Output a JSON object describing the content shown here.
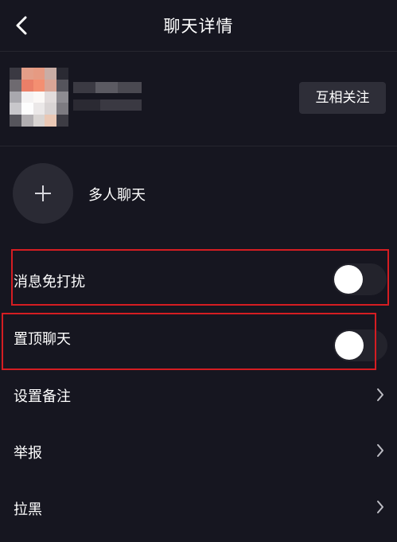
{
  "header": {
    "title": "聊天详情",
    "back_icon": "chevron-left-icon"
  },
  "profile": {
    "avatar_icon": "blurred-avatar",
    "follow_label": "互相关注"
  },
  "group_chat": {
    "icon": "plus-icon",
    "label": "多人聊天"
  },
  "settings": {
    "mute": {
      "label": "消息免打扰",
      "enabled": false
    },
    "pin": {
      "label": "置顶聊天",
      "enabled": false
    },
    "remark": {
      "label": "设置备注",
      "icon": "chevron-right-icon"
    },
    "report": {
      "label": "举报",
      "icon": "chevron-right-icon"
    },
    "block": {
      "label": "拉黑",
      "icon": "chevron-right-icon"
    }
  },
  "colors": {
    "background": "#161620",
    "highlight_box": "#d51d22",
    "follow_button": "#2e2e38"
  }
}
